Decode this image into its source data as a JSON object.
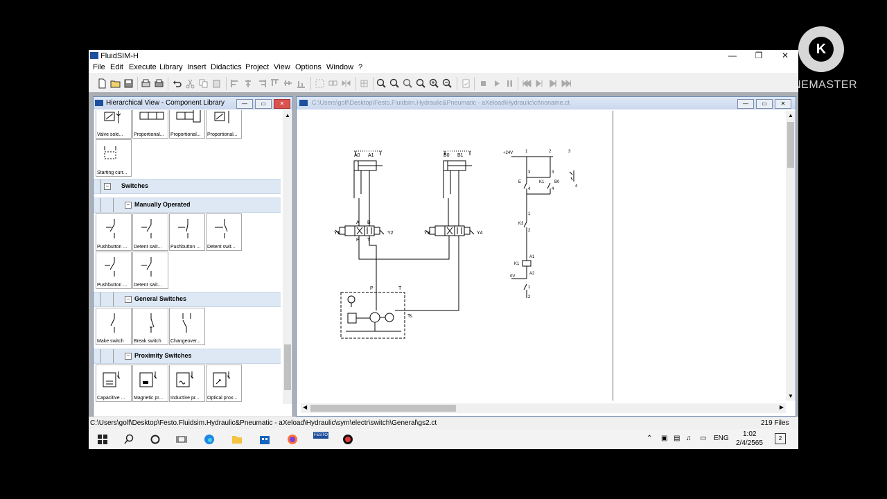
{
  "window": {
    "title": "FluidSIM-H",
    "logo_text": "FESTO"
  },
  "menu": [
    "File",
    "Edit",
    "Execute",
    "Library",
    "Insert",
    "Didactics",
    "Project",
    "View",
    "Options",
    "Window",
    "?"
  ],
  "library": {
    "title": "Hierarchical View - Component Library",
    "top_items": [
      "Valve sole...",
      "Proportional...",
      "Proportional...",
      "Proportional...",
      "Starting curr..."
    ],
    "groups": {
      "switches": "Switches",
      "manual": "Manually Operated",
      "general": "General Switches",
      "proximity": "Proximity Switches"
    },
    "manual_items": [
      "Pushbutton ...",
      "Detent swit...",
      "Pushbutton ...",
      "Detent swit...",
      "Pushbutton ...",
      "Detent swit..."
    ],
    "general_items": [
      "Make switch",
      "Break switch",
      "Changeover..."
    ],
    "proximity_items": [
      "Capacitive ...",
      "Magnetic pr...",
      "Inductive pr...",
      "Optical prox..."
    ]
  },
  "drawing": {
    "title": "C:\\Users\\golf\\Desktop\\Festo.Fluidsim.Hydraulic&Pneumatic - aXeload\\Hydraulic\\ct\\noname.ct",
    "labels": {
      "a0": "A0",
      "a1": "A1",
      "b0": "B0",
      "b1": "B1",
      "y1": "Y1",
      "y2": "Y2",
      "y3": "Y3",
      "y4": "Y4",
      "pa": "A",
      "pb": "B",
      "pp": "P",
      "pt": "T",
      "p2": "P",
      "t2": "T",
      "ts": "Ts",
      "v24": "+24V",
      "n1": "1",
      "n2": "2",
      "n3": "3",
      "e": "E",
      "k1": "K1",
      "b0c": "B0",
      "k3": "K3",
      "k1coil": "K1",
      "a1c": "A1",
      "a2c": "A2",
      "zero": "0V",
      "c3a": "3",
      "c4a": "4",
      "c3b": "3",
      "c4b": "4",
      "c1": "1",
      "c2": "2",
      "c1b": "1",
      "c2b": "2",
      "c4c": "4"
    }
  },
  "status": {
    "path": "C:\\Users\\golf\\Desktop\\Festo.Fluidsim.Hydraulic&Pneumatic - aXeload\\Hydraulic\\sym\\electr\\switch\\General\\gs2.ct",
    "files": "219 Files"
  },
  "taskbar": {
    "lang": "ENG",
    "time": "1:02",
    "date": "2/4/2565",
    "notif_count": "2",
    "festo_label": "FESTO"
  },
  "overlay": {
    "brand": "KINEMASTER"
  }
}
